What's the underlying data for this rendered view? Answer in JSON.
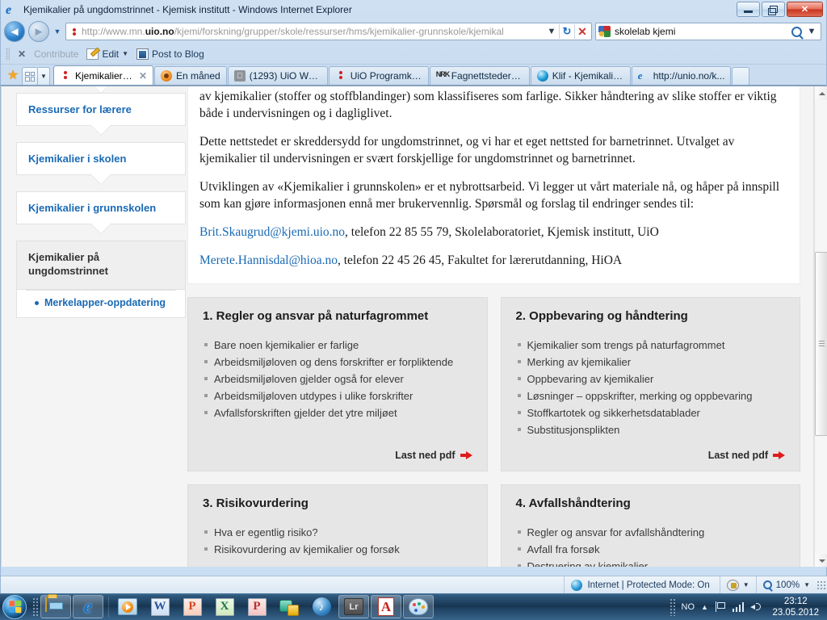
{
  "window": {
    "title": "Kjemikalier på ungdomstrinnet - Kjemisk institutt - Windows Internet Explorer",
    "minimize_label": "Minimize",
    "maximize_label": "Maximize",
    "close_label": "✕"
  },
  "navigation": {
    "back_label": "◄",
    "forward_label": "►",
    "recent_pages_label": "▼",
    "address_prefix": "http://www.mn.",
    "address_domain": "uio.no",
    "address_suffix": "/kjemi/forskning/grupper/skole/ressurser/hms/kjemikalier-grunnskole/kjemikal",
    "address_dropdown_label": "▼",
    "refresh_label": "↻",
    "stop_label": "✕",
    "search_value": "skolelab kjemi",
    "search_dropdown_label": "▼"
  },
  "command_bar": {
    "close_label": "✕",
    "contribute_label": "Contribute",
    "edit_label": "Edit",
    "edit_dropdown_label": "▼",
    "post_to_blog_label": "Post to Blog"
  },
  "tabbar": {
    "favorites_label": "★",
    "tab_list_dropdown": "▼",
    "tabs": [
      {
        "label": "Kjemikalier på ...",
        "favicon": "red-dots-icon",
        "active": true,
        "close_label": "✕"
      },
      {
        "label": "En måned",
        "favicon": "orange-circle-icon",
        "active": false
      },
      {
        "label": "(1293) UiO Webm...",
        "favicon": "gray-apple-icon",
        "active": false
      },
      {
        "label": "UiO Programkiosk",
        "favicon": "red-dots-icon",
        "active": false
      },
      {
        "label": "Fagnettsteder for ...",
        "favicon": "nrk-icon",
        "active": false
      },
      {
        "label": "Klif - Kjemikalier f...",
        "favicon": "blue-globe-icon",
        "active": false
      },
      {
        "label": "http://unio.no/k...",
        "favicon": "ie-icon",
        "active": false
      }
    ]
  },
  "sidebar": {
    "items": [
      {
        "label": "Ressurser for lærere",
        "current": false
      },
      {
        "label": "Kjemikalier i skolen",
        "current": false
      },
      {
        "label": "Kjemikalier i grunnskolen",
        "current": false
      },
      {
        "label": "Kjemikalier på ungdomstrinnet",
        "current": true
      }
    ],
    "sub_items": [
      {
        "label": "Merkelapper-oppdatering"
      }
    ]
  },
  "article": {
    "paragraphs": [
      "av kjemikalier (stoffer og stoffblandinger) som klassifiseres som farlige. Sikker håndtering av slike stoffer er viktig både i undervisningen og i dagliglivet.",
      "Dette nettstedet er skreddersydd for ungdomstrinnet, og vi har et eget nettsted for barnetrinnet. Utvalget av kjemikalier til undervisningen er svært forskjellige for ungdomstrinnet og barnetrinnet.",
      "Utviklingen av «Kjemikalier i grunnskolen» er et nybrottsarbeid. Vi legger ut vårt materiale nå, og håper på innspill som kan gjøre informasjonen ennå mer brukervennlig. Spørsmål og forslag til endringer sendes til:"
    ],
    "contacts": [
      {
        "email": "Brit.Skaugrud@kjemi.uio.no",
        "rest": ", telefon 22 85 55 79, Skolelaboratoriet, Kjemisk institutt, UiO"
      },
      {
        "email": "Merete.Hannisdal@hioa.no",
        "rest": ", telefon 22 45 26 45, Fakultet for lærerutdanning, HiOA"
      }
    ]
  },
  "cards": [
    {
      "title": "1. Regler og ansvar på naturfagrommet",
      "items": [
        "Bare noen kjemikalier er farlige",
        "Arbeidsmiljøloven og dens forskrifter er forpliktende",
        "Arbeidsmiljøloven gjelder også for elever",
        "Arbeidsmiljøloven utdypes i ulike forskrifter",
        "Avfallsforskriften gjelder det ytre miljøet"
      ],
      "pdf_label": "Last ned pdf"
    },
    {
      "title": "2. Oppbevaring og håndtering",
      "items": [
        "Kjemikalier som trengs på naturfagrommet",
        "Merking av kjemikalier",
        "Oppbevaring av kjemikalier",
        "Løsninger – oppskrifter, merking og oppbevaring",
        "Stoffkartotek og sikkerhetsdatablader",
        "Substitusjonsplikten"
      ],
      "pdf_label": "Last ned pdf"
    },
    {
      "title": "3. Risikovurdering",
      "items": [
        "Hva er egentlig risiko?",
        "Risikovurdering av kjemikalier og forsøk"
      ],
      "pdf_label": ""
    },
    {
      "title": "4. Avfallshåndtering",
      "items": [
        "Regler og ansvar for avfallshåndtering",
        "Avfall fra forsøk",
        "Destruering av kjemikalier"
      ],
      "pdf_label": ""
    }
  ],
  "statusbar": {
    "zone_text": "Internet | Protected Mode: On",
    "protected_dropdown": "▼",
    "zoom_level": "100%",
    "zoom_dropdown": "▼"
  },
  "taskbar": {
    "start_label": "Start",
    "buttons": [
      {
        "name": "windows-explorer",
        "icon": "folder-icon",
        "pinned": true
      },
      {
        "name": "internet-explorer",
        "icon": "ie-icon",
        "pinned": true
      },
      {
        "name": "windows-media-player",
        "icon": "media-player-icon",
        "pinned": false
      },
      {
        "name": "microsoft-word",
        "icon": "word-icon",
        "label": "W",
        "pinned": false
      },
      {
        "name": "microsoft-powerpoint",
        "icon": "powerpoint-icon",
        "label": "P",
        "pinned": false
      },
      {
        "name": "microsoft-excel",
        "icon": "excel-icon",
        "label": "X",
        "pinned": false
      },
      {
        "name": "microsoft-publisher",
        "icon": "publisher-icon",
        "label": "P",
        "pinned": false
      },
      {
        "name": "database-security",
        "icon": "database-lock-icon",
        "pinned": false
      },
      {
        "name": "itunes",
        "icon": "itunes-icon",
        "label": "♪",
        "pinned": false
      },
      {
        "name": "lightroom",
        "icon": "lightroom-icon",
        "label": "Lr",
        "pinned": true
      },
      {
        "name": "adobe-reader",
        "icon": "pdf-icon",
        "label": "A",
        "pinned": true
      },
      {
        "name": "paint",
        "icon": "paint-icon",
        "pinned": true
      }
    ],
    "language": "NO",
    "show_hidden_label": "▲",
    "time": "23:12",
    "date": "23.05.2012"
  }
}
